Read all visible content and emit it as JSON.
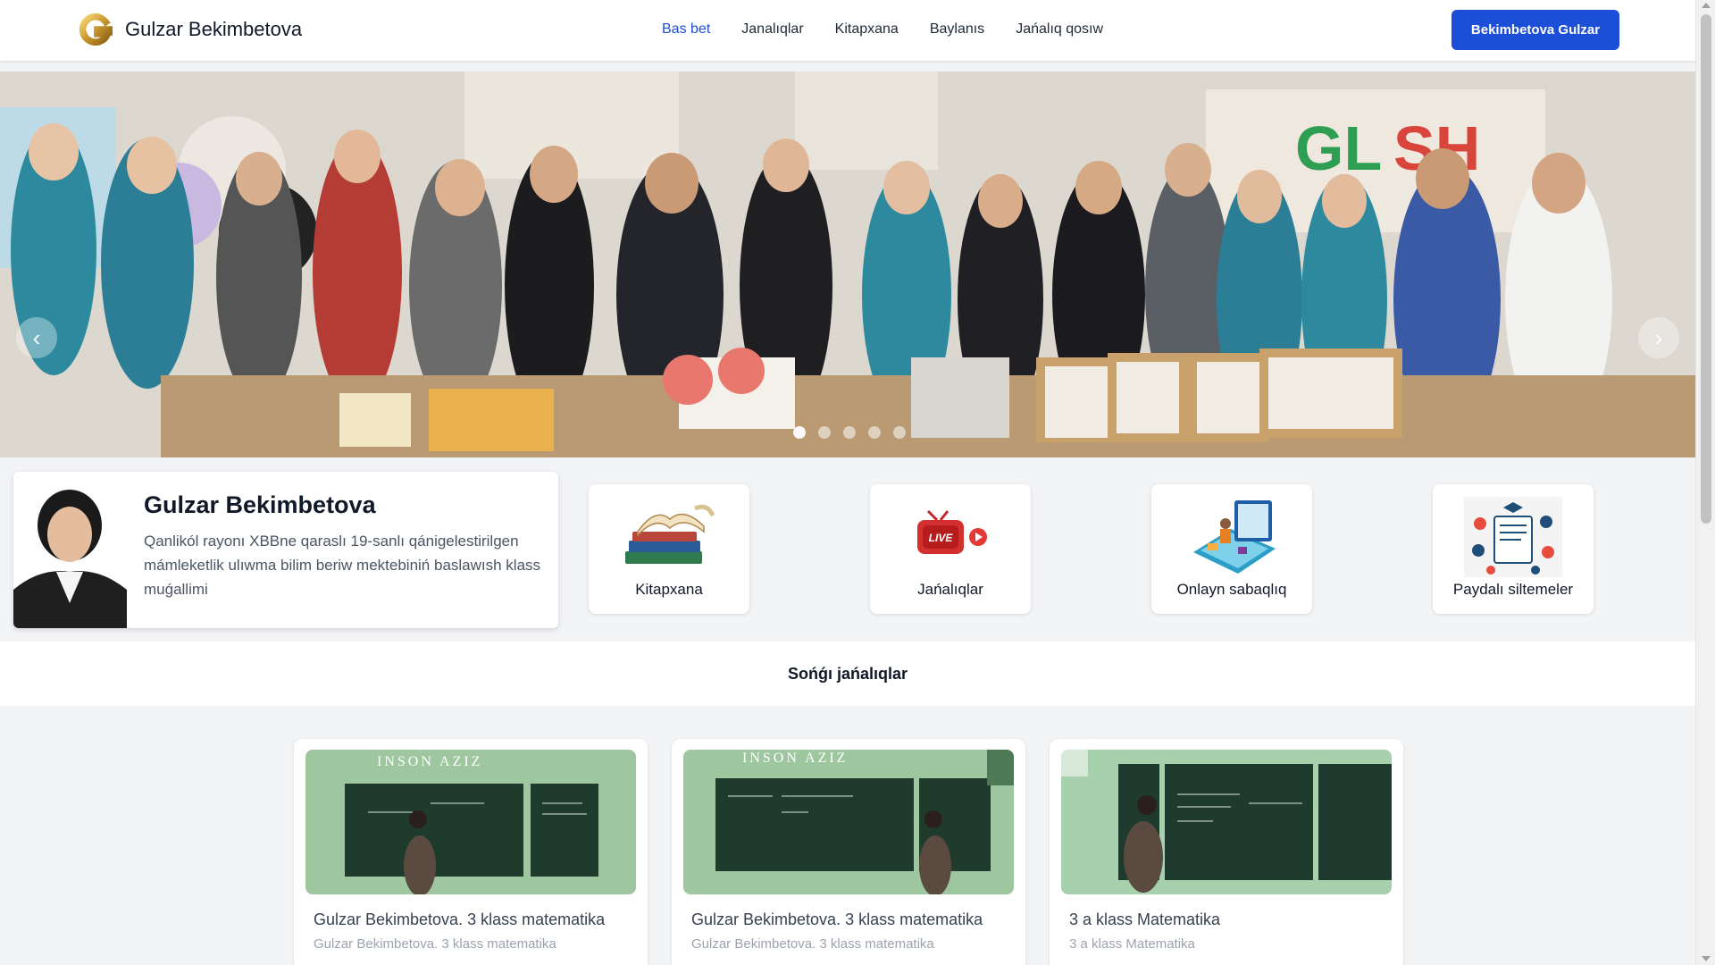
{
  "header": {
    "brand": "Gulzar Bekimbetova",
    "nav": [
      "Bas bet",
      "Janalıqlar",
      "Kitapxana",
      "Baylanıs",
      "Jańalıq qosıw"
    ],
    "active_nav": "Bas bet",
    "cta": "Bekimbetova Gulzar"
  },
  "colors": {
    "primary": "#1d4ed8",
    "page_bg": "#f3f4f6",
    "card_bg": "#ffffff"
  },
  "hero": {
    "prev_icon": "chevron-left-icon",
    "next_icon": "chevron-right-icon",
    "slide_count": 5,
    "active_slide": 1
  },
  "profile": {
    "name": "Gulzar Bekimbetova",
    "description": "Qanlikól rayonı XBBne qaraslı 19-sanlı qánigelestirilgen mámleketlik ulıwma bilim beriw mektebiniń baslawısh klass muǵallimi"
  },
  "quick_links": [
    {
      "label": "Kitapxana",
      "icon": "books-icon"
    },
    {
      "label": "Jańalıqlar",
      "icon": "live-tv-icon"
    },
    {
      "label": "Onlayn sabaqlıq",
      "icon": "online-lesson-icon"
    },
    {
      "label": "Paydalı siltemeler",
      "icon": "useful-links-icon"
    }
  ],
  "news_section": {
    "title": "Sońǵı jańalıqlar"
  },
  "news": [
    {
      "title": "Gulzar Bekimbetova. 3 klass matematika",
      "subtitle": "Gulzar Bekimbetova. 3 klass matematika",
      "banner": "INSON AZIZ"
    },
    {
      "title": "Gulzar Bekimbetova. 3 klass matematika",
      "subtitle": "Gulzar Bekimbetova. 3 klass matematika",
      "banner": "INSON AZIZ"
    },
    {
      "title": "3 a klass Matematika",
      "subtitle": "3 a klass Matematika",
      "banner": ""
    }
  ]
}
